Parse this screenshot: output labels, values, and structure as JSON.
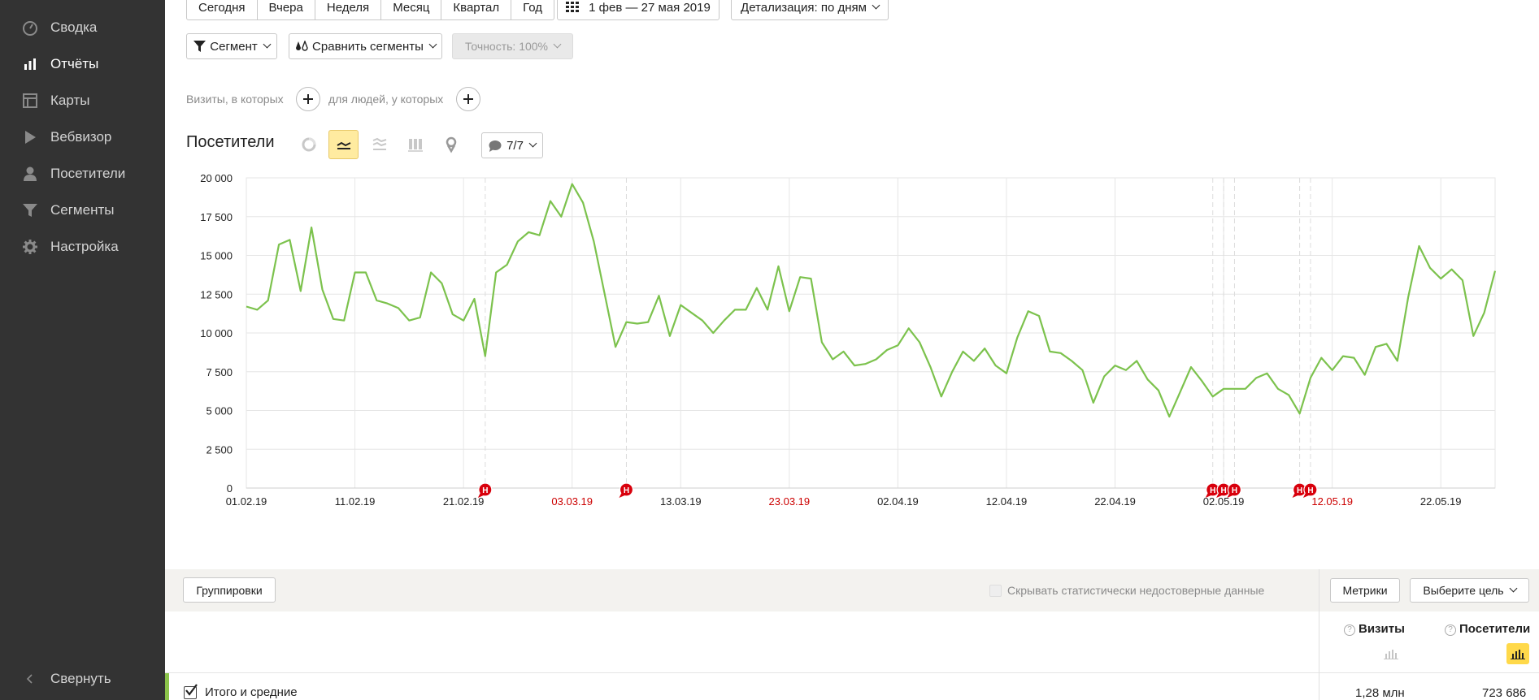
{
  "sidebar": {
    "items": [
      {
        "label": "Сводка",
        "icon": "gauge-icon",
        "active": false
      },
      {
        "label": "Отчёты",
        "icon": "bar-chart-icon",
        "active": true
      },
      {
        "label": "Карты",
        "icon": "map-grid-icon",
        "active": false
      },
      {
        "label": "Вебвизор",
        "icon": "play-icon",
        "active": false
      },
      {
        "label": "Посетители",
        "icon": "user-icon",
        "active": false
      },
      {
        "label": "Сегменты",
        "icon": "funnel-icon",
        "active": false
      },
      {
        "label": "Настройка",
        "icon": "gear-icon",
        "active": false
      }
    ],
    "collapse_label": "Свернуть"
  },
  "period": {
    "tabs": [
      "Сегодня",
      "Вчера",
      "Неделя",
      "Месяц",
      "Квартал",
      "Год"
    ],
    "date_range": "1 фев — 27 мая 2019",
    "detail_label": "Детализация: по дням"
  },
  "filters": {
    "segment_label": "Сегмент",
    "compare_label": "Сравнить сегменты",
    "accuracy_label": "Точность: 100%",
    "visits_condition": "Визиты, в которых",
    "people_condition": "для людей, у которых"
  },
  "chart_header": {
    "title": "Посетители",
    "notes_count": "7/7"
  },
  "chart_data": {
    "type": "line",
    "title": "Посетители",
    "ylim": [
      0,
      20000
    ],
    "y_ticks": [
      "0",
      "2 500",
      "5 000",
      "7 500",
      "10 000",
      "12 500",
      "15 000",
      "17 500",
      "20 000"
    ],
    "x_ticks": [
      {
        "label": "01.02.19",
        "day": 0,
        "holiday": false
      },
      {
        "label": "11.02.19",
        "day": 10,
        "holiday": false
      },
      {
        "label": "21.02.19",
        "day": 20,
        "holiday": false
      },
      {
        "label": "03.03.19",
        "day": 30,
        "holiday": true
      },
      {
        "label": "13.03.19",
        "day": 40,
        "holiday": false
      },
      {
        "label": "23.03.19",
        "day": 50,
        "holiday": true
      },
      {
        "label": "02.04.19",
        "day": 60,
        "holiday": false
      },
      {
        "label": "12.04.19",
        "day": 70,
        "holiday": false
      },
      {
        "label": "22.04.19",
        "day": 80,
        "holiday": false
      },
      {
        "label": "02.05.19",
        "day": 90,
        "holiday": false
      },
      {
        "label": "12.05.19",
        "day": 100,
        "holiday": true
      },
      {
        "label": "22.05.19",
        "day": 110,
        "holiday": false
      }
    ],
    "notes": [
      {
        "day": 22,
        "label": "Н"
      },
      {
        "day": 35,
        "label": "Н"
      },
      {
        "day": 89,
        "label": "Н"
      },
      {
        "day": 90,
        "label": "Н"
      },
      {
        "day": 91,
        "label": "Н"
      },
      {
        "day": 97,
        "label": "Н"
      },
      {
        "day": 98,
        "label": "Н"
      }
    ],
    "grid": true,
    "series": [
      {
        "color": "#7cc24d",
        "values": [
          11700,
          11500,
          12100,
          15700,
          16000,
          12700,
          16800,
          12800,
          10900,
          10800,
          13900,
          13900,
          12100,
          11900,
          11600,
          10800,
          11000,
          13900,
          13200,
          11200,
          10800,
          12200,
          8500,
          13900,
          14400,
          15900,
          16500,
          16300,
          18500,
          17500,
          19600,
          18400,
          15900,
          12500,
          9100,
          10700,
          10600,
          10700,
          12400,
          9800,
          11800,
          11300,
          10800,
          10000,
          10800,
          11500,
          11500,
          12900,
          11500,
          14300,
          11400,
          13600,
          13500,
          9400,
          8300,
          8800,
          7900,
          8000,
          8300,
          8900,
          9200,
          10300,
          9400,
          7800,
          5900,
          7500,
          8800,
          8200,
          9000,
          7900,
          7400,
          9700,
          11400,
          11100,
          8800,
          8700,
          8200,
          7600,
          5500,
          7200,
          7900,
          7600,
          8200,
          7000,
          6300,
          4600,
          6200,
          7800,
          6900,
          5900,
          6400,
          6400,
          6400,
          7100,
          7400,
          6400,
          6000,
          4800,
          7100,
          8400,
          7600,
          8500,
          8400,
          7300,
          9100,
          9300,
          8200,
          12300,
          15600,
          14200,
          13500,
          14100,
          13400,
          9800,
          11300,
          14000
        ]
      }
    ]
  },
  "table": {
    "groupings_label": "Группировки",
    "hide_unreliable_label": "Скрывать статистически недостоверные данные",
    "metrics_label": "Метрики",
    "goal_label": "Выберите цель",
    "columns": [
      {
        "label": "Визиты"
      },
      {
        "label": "Посетители"
      }
    ],
    "total_row": {
      "label": "Итого и средние",
      "visits": "1,28 млн",
      "visitors": "723 686"
    }
  }
}
